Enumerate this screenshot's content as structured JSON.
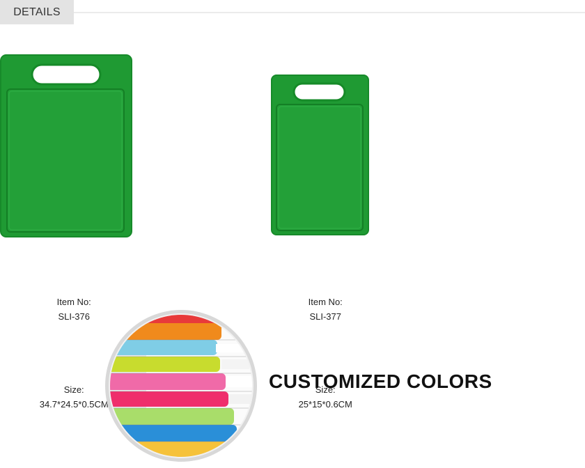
{
  "header": {
    "tab_label": "DETAILS"
  },
  "products": [
    {
      "item_label": "Item No:",
      "item_no": "SLI-376",
      "size_label": "Size:",
      "size": "34.7*24.5*0.5CM",
      "color": "#1f9a33"
    },
    {
      "item_label": "Item No:",
      "item_no": "SLI-377",
      "size_label": "Size:",
      "size": "25*15*0.6CM",
      "color": "#1f9a33"
    }
  ],
  "banner": {
    "headline": "CUSTOMIZED COLORS",
    "stack_colors": [
      "#f08a1c",
      "#7fcde6",
      "#c8dc2e",
      "#f06aa8",
      "#ef2e6c",
      "#a9dd6a",
      "#2a8fd8",
      "#f6c23a"
    ]
  }
}
